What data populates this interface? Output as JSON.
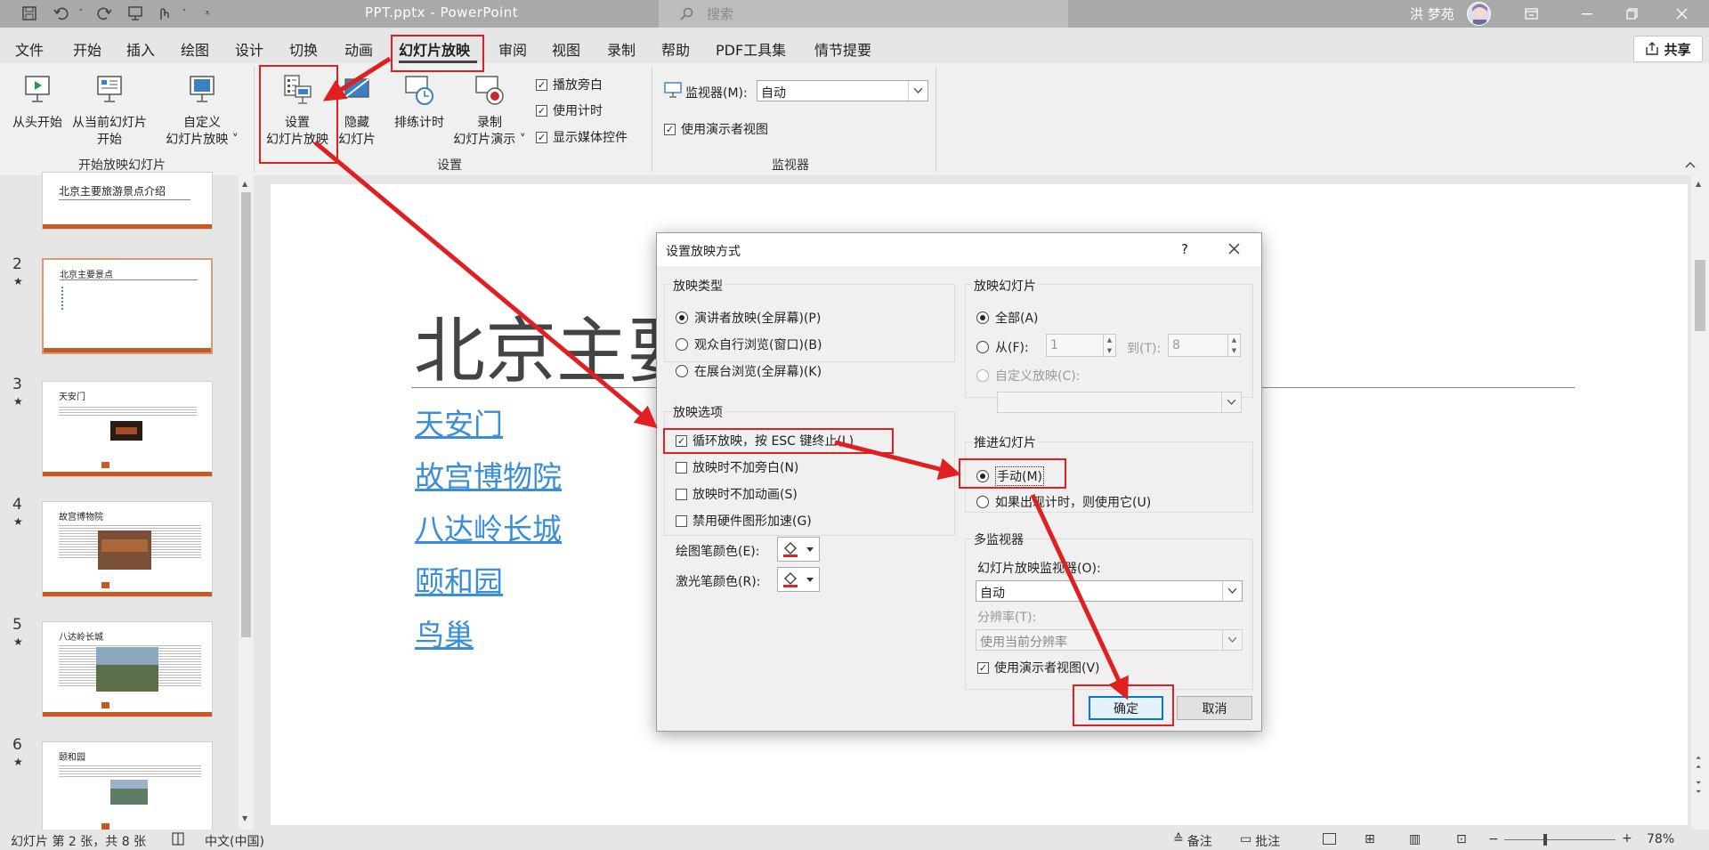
{
  "window": {
    "file_title": "PPT.pptx - PowerPoint",
    "search_placeholder": "搜索",
    "user": "洪 梦苑"
  },
  "tabs": [
    "文件",
    "开始",
    "插入",
    "绘图",
    "设计",
    "切换",
    "动画",
    "幻灯片放映",
    "审阅",
    "视图",
    "录制",
    "帮助",
    "PDF工具集",
    "情节提要"
  ],
  "share_label": "共享",
  "ribbon": {
    "from_beginning": "从头开始",
    "from_current_l1": "从当前幻灯片",
    "from_current_l2": "开始",
    "custom_l1": "自定义",
    "custom_l2": "幻灯片放映 ˅",
    "group_start": "开始放映幻灯片",
    "setup_l1": "设置",
    "setup_l2": "幻灯片放映",
    "hide_l1": "隐藏",
    "hide_l2": "幻灯片",
    "rehearse": "排练计时",
    "record_l1": "录制",
    "record_l2": "幻灯片演示 ˅",
    "play_narrations": "播放旁白",
    "use_timings": "使用计时",
    "show_media": "显示媒体控件",
    "group_setup": "设置",
    "monitor_label": "监视器(M):",
    "monitor_value": "自动",
    "presenter_view": "使用演示者视图",
    "group_monitors": "监视器"
  },
  "thumbnails": [
    {
      "num": "",
      "title": "北京主要旅游景点介绍"
    },
    {
      "num": "2",
      "title": "北京主要景点"
    },
    {
      "num": "3",
      "title": "天安门"
    },
    {
      "num": "4",
      "title": "故宫博物院"
    },
    {
      "num": "5",
      "title": "八达岭长城"
    },
    {
      "num": "6",
      "title": "颐和园"
    }
  ],
  "slide": {
    "title": "北京主要",
    "links": [
      "天安门",
      "故宫博物院",
      "八达岭长城",
      "颐和园",
      "鸟巢"
    ]
  },
  "status": {
    "slide_info": "幻灯片 第 2 张，共 8 张",
    "language": "中文(中国)",
    "notes": "备注",
    "comments": "批注",
    "zoom": "78%"
  },
  "dialog": {
    "title": "设置放映方式",
    "help": "?",
    "show_type_title": "放映类型",
    "show_type": [
      "演讲者放映(全屏幕)(P)",
      "观众自行浏览(窗口)(B)",
      "在展台浏览(全屏幕)(K)"
    ],
    "options_title": "放映选项",
    "options": [
      "循环放映，按 ESC 键终止(L)",
      "放映时不加旁白(N)",
      "放映时不加动画(S)",
      "禁用硬件图形加速(G)"
    ],
    "pen_color": "绘图笔颜色(E):",
    "laser_color": "激光笔颜色(R):",
    "slides_title": "放映幻灯片",
    "all": "全部(A)",
    "from": "从(F):",
    "from_value": "1",
    "to": "到(T):",
    "to_value": "8",
    "custom_show": "自定义放映(C):",
    "advance_title": "推进幻灯片",
    "manual": "手动(M)",
    "timings": "如果出现计时，则使用它(U)",
    "multi_title": "多监视器",
    "monitor_label": "幻灯片放映监视器(O):",
    "monitor_value": "自动",
    "resolution_label": "分辨率(T):",
    "resolution_value": "使用当前分辨率",
    "presenter_view": "使用演示者视图(V)",
    "ok": "确定",
    "cancel": "取消"
  },
  "annotation_color": "#e02020"
}
